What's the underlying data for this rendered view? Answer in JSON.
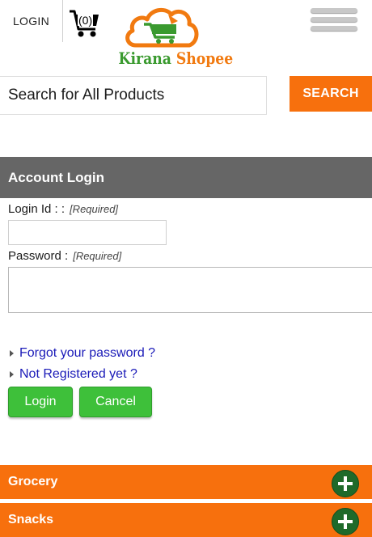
{
  "header": {
    "login_label": "LOGIN",
    "cart_count": "(0)",
    "logo": {
      "part1": "Kirana",
      "part2": "Shopee"
    }
  },
  "search": {
    "placeholder": "Search for All Products",
    "button_label": "SEARCH"
  },
  "account": {
    "title": "Account Login",
    "login_id_label": "Login Id : :",
    "login_id_required": "[Required]",
    "password_label": "Password :",
    "password_required": "[Required]",
    "forgot_link": "Forgot your password ?",
    "register_link": "Not Registered yet ?",
    "login_button": "Login",
    "cancel_button": "Cancel"
  },
  "categories": [
    {
      "label": "Grocery"
    },
    {
      "label": "Snacks"
    }
  ],
  "colors": {
    "brand_orange": "#f7700d",
    "brand_green": "#3ec03a",
    "panel_grey": "#666666",
    "link_blue": "#1a1ab8"
  }
}
